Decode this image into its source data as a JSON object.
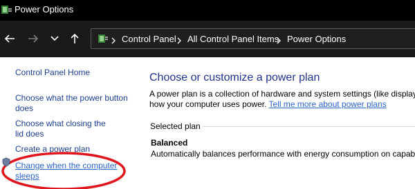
{
  "window": {
    "title": "Power Options",
    "icon": "power-options-icon"
  },
  "navigation": {
    "back_icon": "arrow-left-icon",
    "forward_icon": "arrow-right-icon",
    "recent_icon": "chevron-down-icon",
    "up_icon": "arrow-up-icon",
    "breadcrumb": [
      "Control Panel",
      "All Control Panel Items",
      "Power Options"
    ]
  },
  "sidebar": {
    "items": [
      {
        "label": "Control Panel Home"
      },
      {
        "label": "Choose what the power button does"
      },
      {
        "label": "Choose what closing the lid does"
      },
      {
        "label": "Create a power plan"
      },
      {
        "label": "Change when the computer sleeps"
      }
    ]
  },
  "main": {
    "heading": "Choose or customize a power plan",
    "description_line1": "A power plan is a collection of hardware and system settings (like display",
    "description_line2": "how your computer uses power. ",
    "learn_more_link": "Tell me more about power plans",
    "section_label": "Selected plan",
    "plan_name": "Balanced",
    "plan_description": "Automatically balances performance with energy consumption on capab"
  },
  "colors": {
    "titlebar": "#000000",
    "navbar": "#1a1a1a",
    "link": "#1a3f8f",
    "heading": "#1e3287",
    "annotation": "#e0161e"
  }
}
